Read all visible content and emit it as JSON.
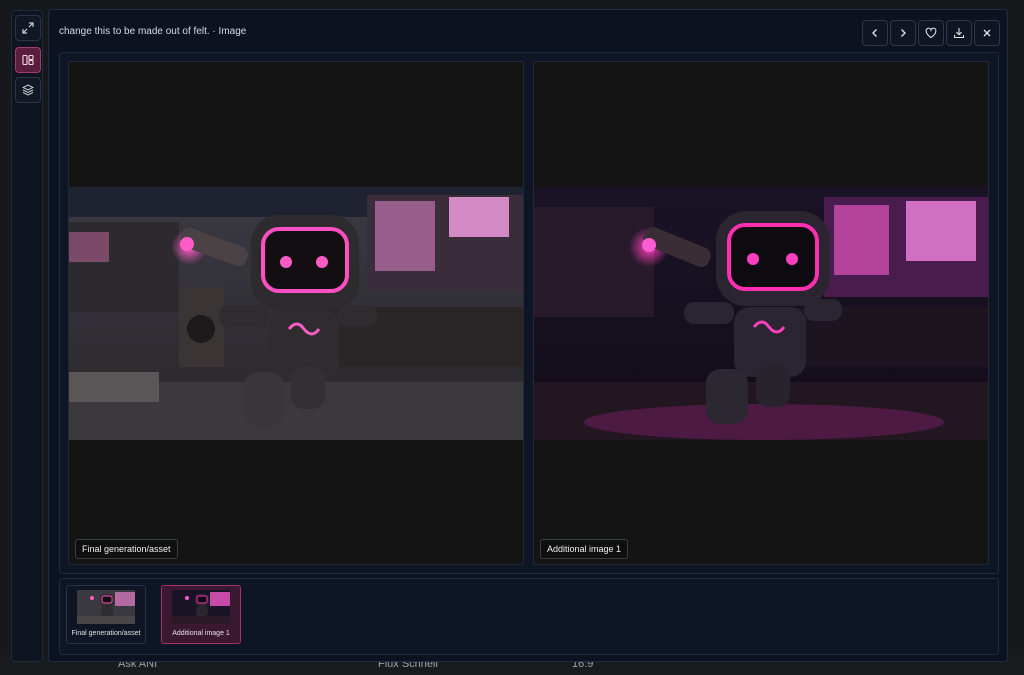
{
  "modal": {
    "title": "change this to be made out of felt. · Image"
  },
  "toolbar": {
    "prev_icon": "chevron-left-icon",
    "next_icon": "chevron-right-icon",
    "favorite_icon": "heart-icon",
    "download_icon": "download-icon",
    "close_icon": "close-icon"
  },
  "left_rail": {
    "items": [
      {
        "icon": "expand-icon"
      },
      {
        "icon": "split-view-icon",
        "active": true
      },
      {
        "icon": "layers-icon"
      }
    ]
  },
  "panels": [
    {
      "caption": "Final generation/asset"
    },
    {
      "caption": "Additional image 1"
    }
  ],
  "thumbnails": [
    {
      "label": "Final generation/asset",
      "selected": false
    },
    {
      "label": "Additional image 1",
      "selected": true
    }
  ],
  "background_bar": {
    "ask": "Ask ANI",
    "fmt": "Flux Schnell",
    "ratio": "16:9"
  },
  "colors": {
    "accent": "#a43a6c",
    "modal_bg": "#0c1220",
    "panel_bg": "#141414"
  }
}
